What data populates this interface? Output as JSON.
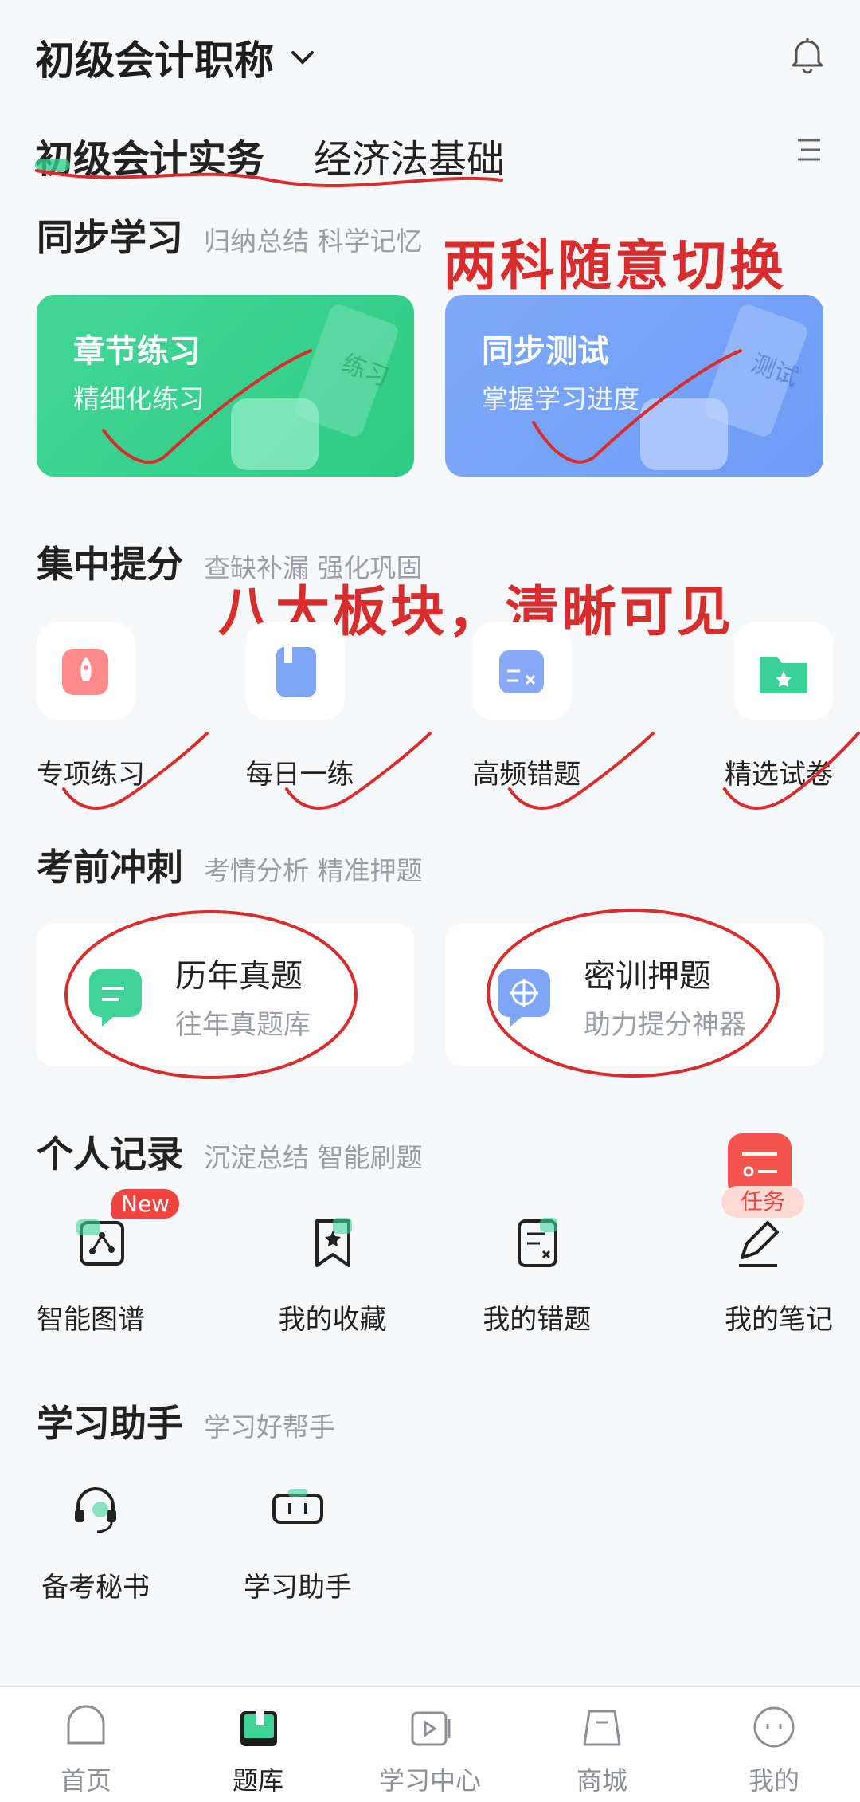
{
  "header": {
    "title": "初级会计职称",
    "tabs": [
      "初级会计实务",
      "经济法基础"
    ]
  },
  "annotations": {
    "switch_note": "两科随意切换",
    "blocks_note": "八大板块，清晰可见"
  },
  "sync_learning": {
    "title": "同步学习",
    "subtitle": "归纳总结 科学记忆",
    "cards": [
      {
        "title": "章节练习",
        "subtitle": "精细化练习",
        "stamp": "练习"
      },
      {
        "title": "同步测试",
        "subtitle": "掌握学习进度",
        "stamp": "测试"
      }
    ]
  },
  "focus": {
    "title": "集中提分",
    "subtitle": "查缺补漏 强化巩固",
    "items": [
      "专项练习",
      "每日一练",
      "高频错题",
      "精选试卷"
    ]
  },
  "sprint": {
    "title": "考前冲刺",
    "subtitle": "考情分析 精准押题",
    "cards": [
      {
        "title": "历年真题",
        "subtitle": "往年真题库"
      },
      {
        "title": "密训押题",
        "subtitle": "助力提分神器"
      }
    ]
  },
  "records": {
    "title": "个人记录",
    "subtitle": "沉淀总结 智能刷题",
    "items": [
      "智能图谱",
      "我的收藏",
      "我的错题",
      "我的笔记"
    ],
    "new_badge": "New",
    "task_badge": "任务"
  },
  "assistant": {
    "title": "学习助手",
    "subtitle": "学习好帮手",
    "items": [
      "备考秘书",
      "学习助手"
    ]
  },
  "nav": {
    "items": [
      "首页",
      "题库",
      "学习中心",
      "商城",
      "我的"
    ],
    "active_index": 1
  },
  "colors": {
    "accent_red": "#d92d2d",
    "green": "#35cf8c",
    "blue": "#78a4f7"
  }
}
